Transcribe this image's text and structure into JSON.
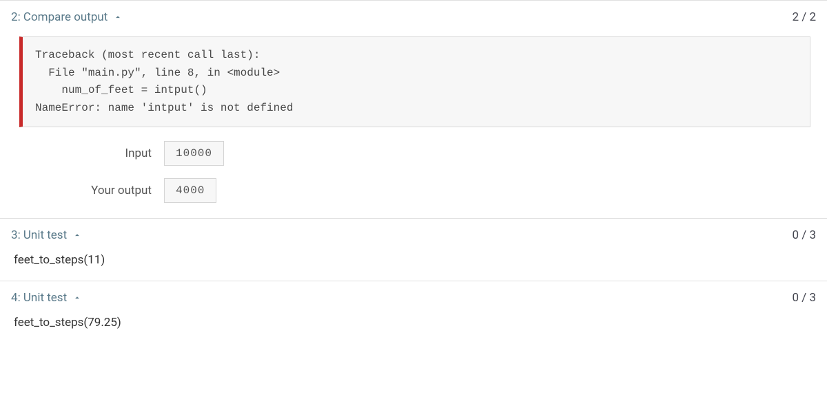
{
  "tests": [
    {
      "number": "2",
      "title": "Compare output",
      "score": "2 / 2",
      "error": "Traceback (most recent call last):\n  File \"main.py\", line 8, in <module>\n    num_of_feet = intput()\nNameError: name 'intput' is not defined",
      "io": {
        "input_label": "Input",
        "input_value": "10000",
        "output_label": "Your output",
        "output_value": "4000"
      }
    },
    {
      "number": "3",
      "title": "Unit test",
      "score": "0 / 3",
      "desc": "feet_to_steps(11)"
    },
    {
      "number": "4",
      "title": "Unit test",
      "score": "0 / 3",
      "desc": "feet_to_steps(79.25)"
    }
  ]
}
